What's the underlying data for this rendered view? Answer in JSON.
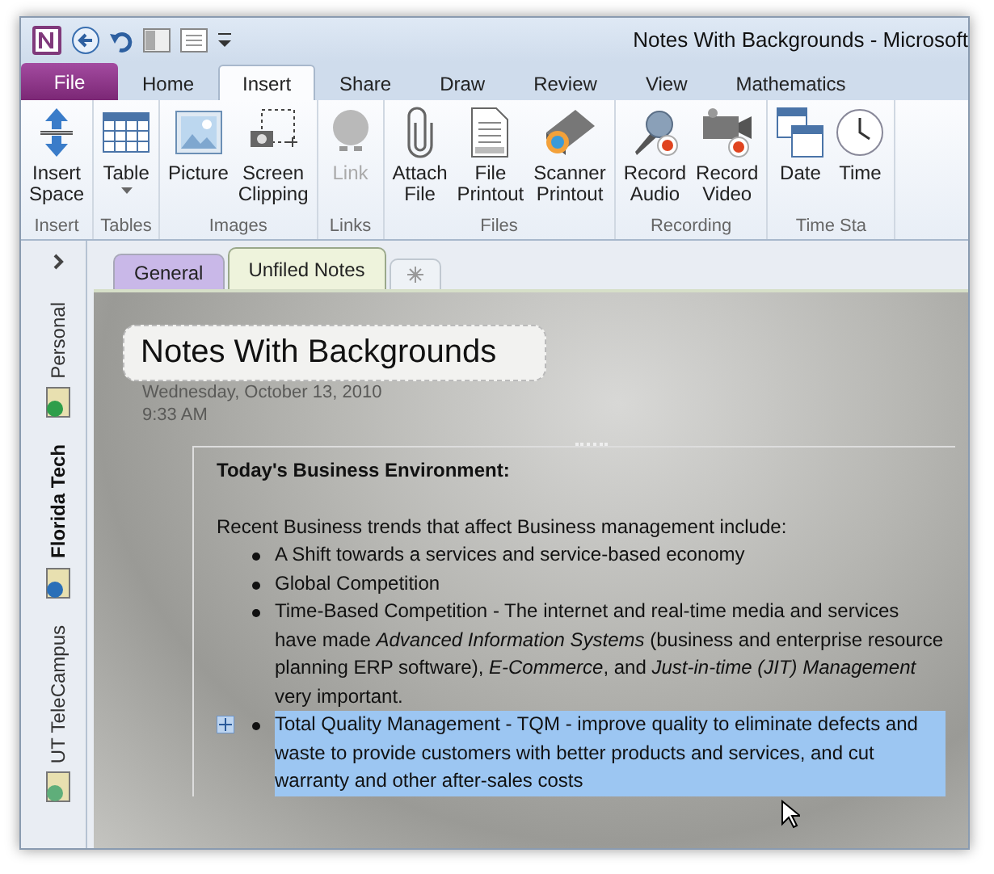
{
  "window": {
    "title": "Notes With Backgrounds - Microsoft"
  },
  "ribbon_tabs": [
    {
      "label": "File",
      "kind": "file",
      "selected": false
    },
    {
      "label": "Home",
      "kind": "tab",
      "selected": false
    },
    {
      "label": "Insert",
      "kind": "tab",
      "selected": true
    },
    {
      "label": "Share",
      "kind": "tab",
      "selected": false
    },
    {
      "label": "Draw",
      "kind": "tab",
      "selected": false
    },
    {
      "label": "Review",
      "kind": "tab",
      "selected": false
    },
    {
      "label": "View",
      "kind": "tab",
      "selected": false
    },
    {
      "label": "Mathematics",
      "kind": "tab",
      "selected": false
    }
  ],
  "ribbon_groups": [
    {
      "label": "Insert",
      "buttons": [
        {
          "lines": [
            "Insert",
            "Space"
          ],
          "kind": "insert-space",
          "disabled": false
        }
      ]
    },
    {
      "label": "Tables",
      "buttons": [
        {
          "lines": [
            "Table"
          ],
          "kind": "table",
          "disabled": false,
          "dropdown": true
        }
      ]
    },
    {
      "label": "Images",
      "buttons": [
        {
          "lines": [
            "Picture"
          ],
          "kind": "picture",
          "disabled": false
        },
        {
          "lines": [
            "Screen",
            "Clipping"
          ],
          "kind": "clipping",
          "disabled": false
        }
      ]
    },
    {
      "label": "Links",
      "buttons": [
        {
          "lines": [
            "Link"
          ],
          "kind": "link",
          "disabled": true
        }
      ]
    },
    {
      "label": "Files",
      "buttons": [
        {
          "lines": [
            "Attach",
            "File"
          ],
          "kind": "attach",
          "disabled": false
        },
        {
          "lines": [
            "File",
            "Printout"
          ],
          "kind": "printout",
          "disabled": false
        },
        {
          "lines": [
            "Scanner",
            "Printout"
          ],
          "kind": "scanner",
          "disabled": false
        }
      ]
    },
    {
      "label": "Recording",
      "buttons": [
        {
          "lines": [
            "Record",
            "Audio"
          ],
          "kind": "audio",
          "disabled": false
        },
        {
          "lines": [
            "Record",
            "Video"
          ],
          "kind": "video",
          "disabled": false
        }
      ]
    },
    {
      "label": "Time Sta",
      "buttons": [
        {
          "lines": [
            "Date"
          ],
          "kind": "date",
          "disabled": false
        },
        {
          "lines": [
            "Time"
          ],
          "kind": "time",
          "disabled": false
        }
      ]
    }
  ],
  "notebooks": [
    {
      "label": "Personal",
      "selected": false,
      "color": "#2e9e4a"
    },
    {
      "label": "Florida Tech",
      "selected": true,
      "color": "#2a6fb8"
    },
    {
      "label": "UT TeleCampus",
      "selected": false,
      "color": "#5fae7a"
    }
  ],
  "section_tabs": [
    {
      "label": "General",
      "selected": false,
      "color": "#c9b8e8"
    },
    {
      "label": "Unfiled Notes",
      "selected": true,
      "color": "#eef3dc"
    }
  ],
  "page": {
    "title": "Notes With Backgrounds",
    "date": "Wednesday, October 13, 2010",
    "time": "9:33 AM",
    "heading": "Today's Business Environment:",
    "intro": "Recent Business trends that affect Business management include:",
    "bullets": [
      {
        "text": "A Shift towards a services and service-based economy",
        "selected": false
      },
      {
        "text": "Global Competition",
        "selected": false
      },
      {
        "text": "Time-Based Competition - The internet and real-time media and services have made *Advanced Information Systems* (business and enterprise resource planning ERP software), *E-Commerce*, and *Just-in-time (JIT) Management* very important.",
        "selected": false
      },
      {
        "text": "Total Quality Management - TQM - improve quality to eliminate defects and waste to provide customers with better products and services, and cut warranty and other after-sales costs",
        "selected": true
      }
    ]
  }
}
